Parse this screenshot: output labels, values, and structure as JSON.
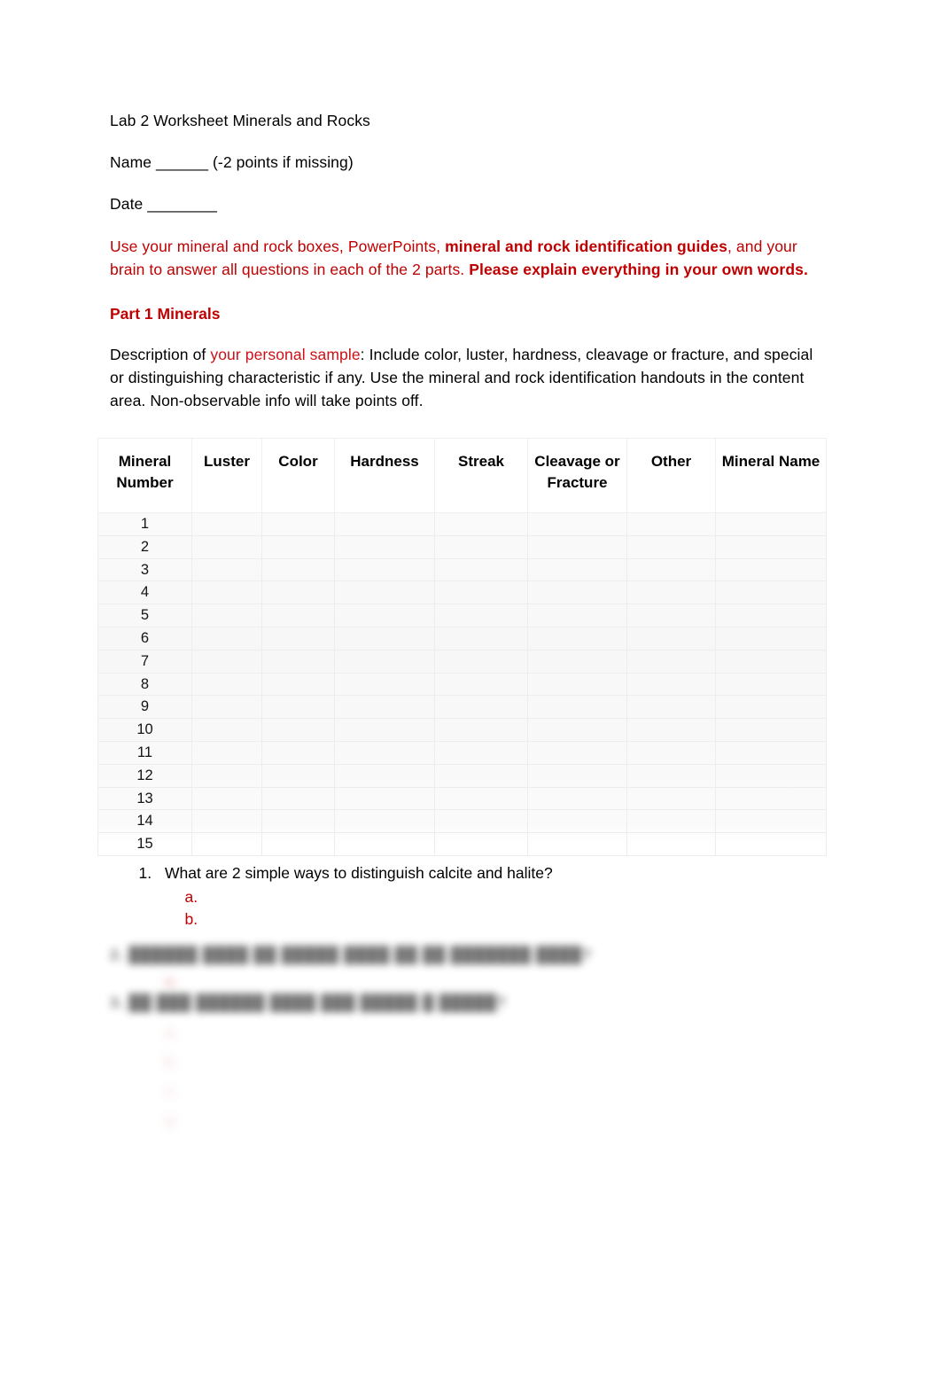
{
  "document": {
    "title": "Lab 2 Worksheet Minerals and Rocks",
    "name_line": "Name ______ (-2 points if missing)",
    "date_line": "Date ________"
  },
  "alert": {
    "seg1": "Use your mineral and rock boxes, PowerPoints, ",
    "seg2_bold": "mineral and rock identification guides",
    "seg3": ", and your brain to answer all questions in each of the 2 parts. ",
    "seg4_bold": "Please explain everything in your own words."
  },
  "part1": {
    "heading": "Part 1 Minerals",
    "desc_seg1": "Description of ",
    "desc_seg2_red": "your personal sample",
    "desc_seg3": ": Include color, luster, hardness, cleavage or fracture, and special or distinguishing characteristic if any. Use the mineral and rock identification handouts in the content area. Non-observable info will take points off."
  },
  "table": {
    "headers": [
      "Mineral Number",
      "Luster",
      "Color",
      "Hardness",
      "Streak",
      "Cleavage or Fracture",
      "Other",
      "Mineral Name"
    ],
    "row_numbers": [
      "1",
      "2",
      "3",
      "4",
      "5",
      "6",
      "7",
      "8",
      "9",
      "10",
      "11",
      "12",
      "13",
      "14",
      "15"
    ]
  },
  "questions": {
    "q1": {
      "text": "What are 2 simple ways to distinguish calcite and halite?",
      "sub_a": "",
      "sub_b": ""
    },
    "q2_obscured": "2.  ██████ ████ ██ █████ ████ ██ ██ ███████ ████?",
    "q2a_obscured": "a.",
    "q3_obscured": "3.  ██ ███ ██████ ████ ███ █████ █ █████?",
    "q3_subs_obscured": [
      "a.",
      "b.",
      "c.",
      "d."
    ]
  },
  "colors": {
    "red_dark": "#C00000",
    "red_bright": "#CC1015",
    "text": "#000000",
    "table_gridline": "#ededee",
    "page_background": "#ffffff"
  }
}
